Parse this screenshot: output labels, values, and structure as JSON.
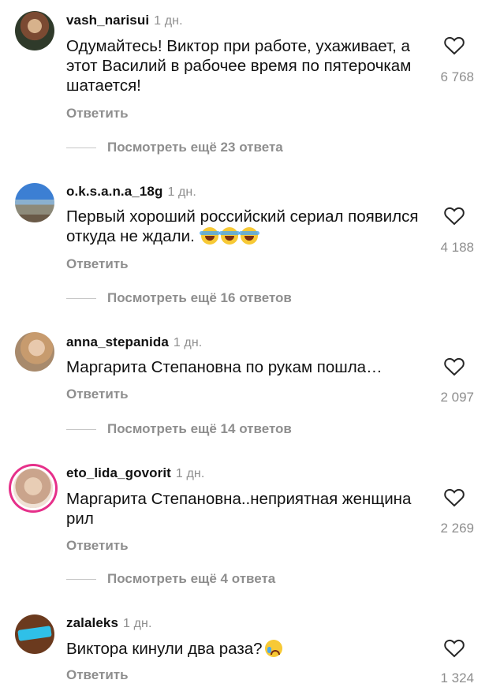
{
  "comments": [
    {
      "username": "vash_narisui",
      "time": "1 дн.",
      "text": "Одумайтесь! Виктор при работе, ухаживает, а этот Василий в рабочее время по пятерочкам шатается!",
      "likes": "6 768",
      "reply_label": "Ответить",
      "more_label": "Посмотреть ещё 23 ответа"
    },
    {
      "username": "o.k.s.a.n.a_18g",
      "time": "1 дн.",
      "text": "Первый хороший российский сериал появился откуда не ждали.",
      "emoji": [
        "face-with-tears-of-joy",
        "face-with-tears-of-joy",
        "face-with-tears-of-joy"
      ],
      "likes": "4 188",
      "reply_label": "Ответить",
      "more_label": "Посмотреть ещё 16 ответов"
    },
    {
      "username": "anna_stepanida",
      "time": "1 дн.",
      "text": "Маргарита Степановна по рукам пошла…",
      "likes": "2 097",
      "reply_label": "Ответить",
      "more_label": "Посмотреть ещё 14 ответов"
    },
    {
      "username": "eto_lida_govorit",
      "time": "1 дн.",
      "text": "Маргарита Степановна..неприятная женщина рил",
      "likes": "2 269",
      "reply_label": "Ответить",
      "more_label": "Посмотреть ещё 4 ответа",
      "has_story_ring": true
    },
    {
      "username": "zalaleks",
      "time": "1 дн.",
      "text": "Виктора кинули два раза?",
      "emoji": [
        "crying-face"
      ],
      "likes": "1 324",
      "reply_label": "Ответить"
    }
  ],
  "icons": {
    "like": "heart-outline-icon"
  },
  "colors": {
    "secondary_text": "#8e8e8e",
    "story_ring": "#e6308a"
  }
}
